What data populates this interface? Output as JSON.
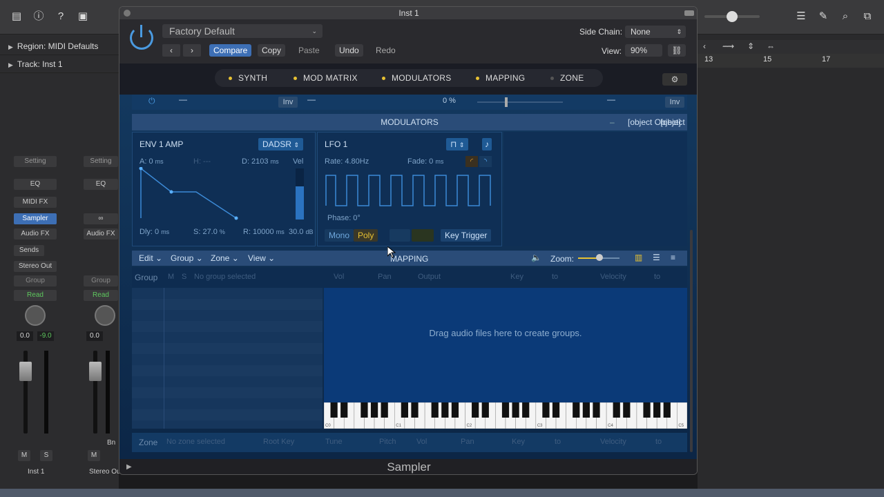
{
  "window_title": "Inst 1",
  "preset": "Factory Default",
  "header": {
    "compare": "Compare",
    "copy": "Copy",
    "paste": "Paste",
    "undo": "Undo",
    "redo": "Redo",
    "side_chain_label": "Side Chain:",
    "side_chain_value": "None",
    "view_label": "View:",
    "view_value": "90%"
  },
  "nav_tabs": [
    "SYNTH",
    "MOD MATRIX",
    "MODULATORS",
    "MAPPING",
    "ZONE"
  ],
  "inspector": {
    "region": "Region:",
    "region_value": "MIDI Defaults",
    "track": "Track:",
    "track_value": "Inst 1"
  },
  "strip1": {
    "setting": "Setting",
    "eq": "EQ",
    "midifx": "MIDI FX",
    "instrument": "Sampler",
    "audiofx": "Audio FX",
    "sends": "Sends",
    "output": "Stereo Out",
    "group": "Group",
    "read": "Read",
    "vol": "0.0",
    "pan": "-9.0",
    "m": "M",
    "s": "S",
    "name": "Inst 1"
  },
  "strip2": {
    "setting": "Setting",
    "eq": "EQ",
    "audiofx": "Audio FX",
    "group": "Group",
    "read": "Read",
    "vol": "0.0",
    "m": "M",
    "name": "Stereo Out",
    "bn": "Bn"
  },
  "ruler": [
    "13",
    "15",
    "17"
  ],
  "mod_row": {
    "inv1": "Inv",
    "pct": "0 %",
    "inv2": "Inv"
  },
  "modulators": {
    "title": "MODULATORS",
    "minus": "–",
    "env": {
      "name": "ENV 1 AMP",
      "mode": "DADSR",
      "a": "A: 0",
      "a_unit": "ms",
      "h": "H: ---",
      "d": "D: 2103",
      "d_unit": "ms",
      "vel": "Vel",
      "dly": "Dly: 0",
      "dly_unit": "ms",
      "s": "S: 27.0",
      "s_unit": "%",
      "r": "R: 10000",
      "r_unit": "ms",
      "db": "30.0",
      "db_unit": "dB"
    },
    "lfo": {
      "name": "LFO 1",
      "rate": "Rate: 4.80Hz",
      "fade": "Fade: 0",
      "fade_unit": "ms",
      "phase": "Phase: 0°",
      "mono": "Mono",
      "poly": "Poly",
      "key_trigger": "Key Trigger"
    }
  },
  "mapping": {
    "edit": "Edit",
    "group": "Group",
    "zone": "Zone",
    "view": "View",
    "title": "MAPPING",
    "zoom": "Zoom:",
    "group_lbl": "Group",
    "m": "M",
    "s": "S",
    "no_group": "No group selected",
    "vol": "Vol",
    "pan": "Pan",
    "output": "Output",
    "key": "Key",
    "to": "to",
    "velocity": "Velocity",
    "drop": "Drag audio files here to create groups.",
    "octaves": [
      "C0",
      "C1",
      "C2",
      "C3",
      "C4",
      "C5"
    ],
    "zone_lbl": "Zone",
    "no_zone": "No zone selected",
    "root_key": "Root Key",
    "tune": "Tune",
    "pitch": "Pitch"
  },
  "footer": "Sampler"
}
